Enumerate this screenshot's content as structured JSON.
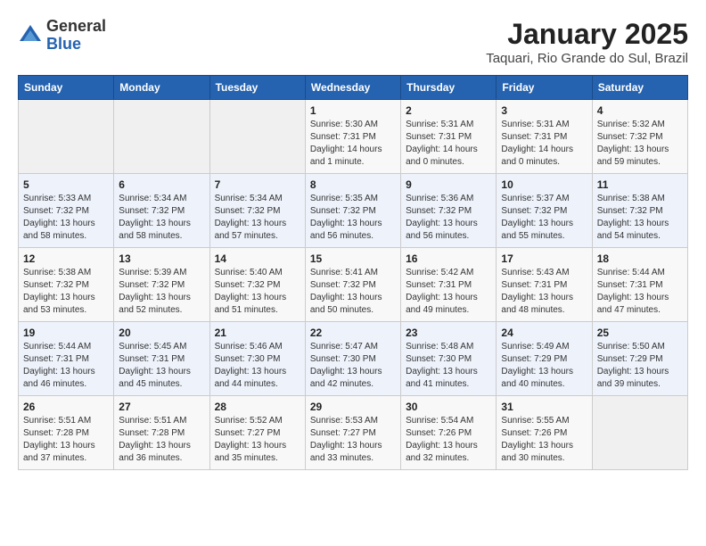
{
  "header": {
    "logo_general": "General",
    "logo_blue": "Blue",
    "title": "January 2025",
    "subtitle": "Taquari, Rio Grande do Sul, Brazil"
  },
  "days_of_week": [
    "Sunday",
    "Monday",
    "Tuesday",
    "Wednesday",
    "Thursday",
    "Friday",
    "Saturday"
  ],
  "weeks": [
    [
      {
        "day": "",
        "info": ""
      },
      {
        "day": "",
        "info": ""
      },
      {
        "day": "",
        "info": ""
      },
      {
        "day": "1",
        "info": "Sunrise: 5:30 AM\nSunset: 7:31 PM\nDaylight: 14 hours\nand 1 minute."
      },
      {
        "day": "2",
        "info": "Sunrise: 5:31 AM\nSunset: 7:31 PM\nDaylight: 14 hours\nand 0 minutes."
      },
      {
        "day": "3",
        "info": "Sunrise: 5:31 AM\nSunset: 7:31 PM\nDaylight: 14 hours\nand 0 minutes."
      },
      {
        "day": "4",
        "info": "Sunrise: 5:32 AM\nSunset: 7:32 PM\nDaylight: 13 hours\nand 59 minutes."
      }
    ],
    [
      {
        "day": "5",
        "info": "Sunrise: 5:33 AM\nSunset: 7:32 PM\nDaylight: 13 hours\nand 58 minutes."
      },
      {
        "day": "6",
        "info": "Sunrise: 5:34 AM\nSunset: 7:32 PM\nDaylight: 13 hours\nand 58 minutes."
      },
      {
        "day": "7",
        "info": "Sunrise: 5:34 AM\nSunset: 7:32 PM\nDaylight: 13 hours\nand 57 minutes."
      },
      {
        "day": "8",
        "info": "Sunrise: 5:35 AM\nSunset: 7:32 PM\nDaylight: 13 hours\nand 56 minutes."
      },
      {
        "day": "9",
        "info": "Sunrise: 5:36 AM\nSunset: 7:32 PM\nDaylight: 13 hours\nand 56 minutes."
      },
      {
        "day": "10",
        "info": "Sunrise: 5:37 AM\nSunset: 7:32 PM\nDaylight: 13 hours\nand 55 minutes."
      },
      {
        "day": "11",
        "info": "Sunrise: 5:38 AM\nSunset: 7:32 PM\nDaylight: 13 hours\nand 54 minutes."
      }
    ],
    [
      {
        "day": "12",
        "info": "Sunrise: 5:38 AM\nSunset: 7:32 PM\nDaylight: 13 hours\nand 53 minutes."
      },
      {
        "day": "13",
        "info": "Sunrise: 5:39 AM\nSunset: 7:32 PM\nDaylight: 13 hours\nand 52 minutes."
      },
      {
        "day": "14",
        "info": "Sunrise: 5:40 AM\nSunset: 7:32 PM\nDaylight: 13 hours\nand 51 minutes."
      },
      {
        "day": "15",
        "info": "Sunrise: 5:41 AM\nSunset: 7:32 PM\nDaylight: 13 hours\nand 50 minutes."
      },
      {
        "day": "16",
        "info": "Sunrise: 5:42 AM\nSunset: 7:31 PM\nDaylight: 13 hours\nand 49 minutes."
      },
      {
        "day": "17",
        "info": "Sunrise: 5:43 AM\nSunset: 7:31 PM\nDaylight: 13 hours\nand 48 minutes."
      },
      {
        "day": "18",
        "info": "Sunrise: 5:44 AM\nSunset: 7:31 PM\nDaylight: 13 hours\nand 47 minutes."
      }
    ],
    [
      {
        "day": "19",
        "info": "Sunrise: 5:44 AM\nSunset: 7:31 PM\nDaylight: 13 hours\nand 46 minutes."
      },
      {
        "day": "20",
        "info": "Sunrise: 5:45 AM\nSunset: 7:31 PM\nDaylight: 13 hours\nand 45 minutes."
      },
      {
        "day": "21",
        "info": "Sunrise: 5:46 AM\nSunset: 7:30 PM\nDaylight: 13 hours\nand 44 minutes."
      },
      {
        "day": "22",
        "info": "Sunrise: 5:47 AM\nSunset: 7:30 PM\nDaylight: 13 hours\nand 42 minutes."
      },
      {
        "day": "23",
        "info": "Sunrise: 5:48 AM\nSunset: 7:30 PM\nDaylight: 13 hours\nand 41 minutes."
      },
      {
        "day": "24",
        "info": "Sunrise: 5:49 AM\nSunset: 7:29 PM\nDaylight: 13 hours\nand 40 minutes."
      },
      {
        "day": "25",
        "info": "Sunrise: 5:50 AM\nSunset: 7:29 PM\nDaylight: 13 hours\nand 39 minutes."
      }
    ],
    [
      {
        "day": "26",
        "info": "Sunrise: 5:51 AM\nSunset: 7:28 PM\nDaylight: 13 hours\nand 37 minutes."
      },
      {
        "day": "27",
        "info": "Sunrise: 5:51 AM\nSunset: 7:28 PM\nDaylight: 13 hours\nand 36 minutes."
      },
      {
        "day": "28",
        "info": "Sunrise: 5:52 AM\nSunset: 7:27 PM\nDaylight: 13 hours\nand 35 minutes."
      },
      {
        "day": "29",
        "info": "Sunrise: 5:53 AM\nSunset: 7:27 PM\nDaylight: 13 hours\nand 33 minutes."
      },
      {
        "day": "30",
        "info": "Sunrise: 5:54 AM\nSunset: 7:26 PM\nDaylight: 13 hours\nand 32 minutes."
      },
      {
        "day": "31",
        "info": "Sunrise: 5:55 AM\nSunset: 7:26 PM\nDaylight: 13 hours\nand 30 minutes."
      },
      {
        "day": "",
        "info": ""
      }
    ]
  ]
}
